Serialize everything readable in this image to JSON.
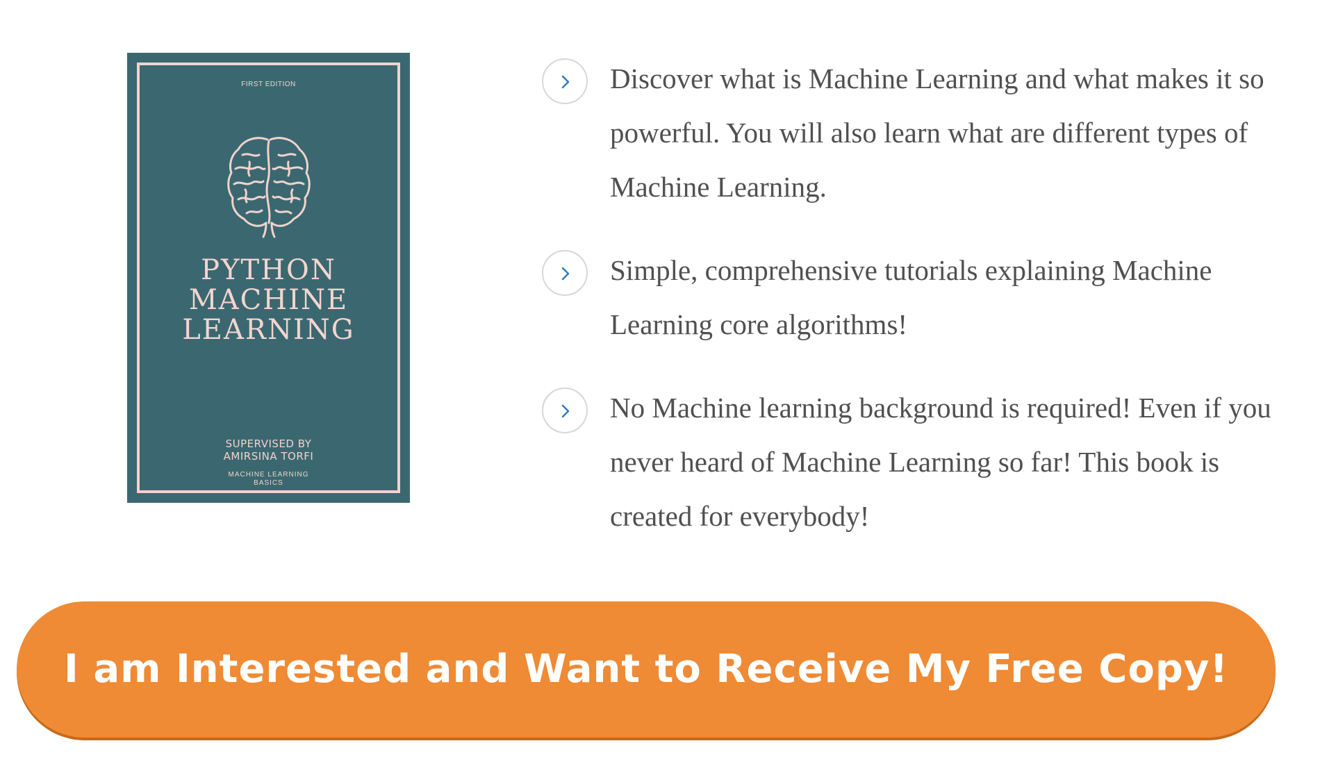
{
  "book": {
    "edition": "FIRST EDITION",
    "title_lines": [
      "PYTHON",
      "MACHINE",
      "LEARNING"
    ],
    "supervised_lines": [
      "SUPERVISED BY",
      "AMIRSINA TORFI"
    ],
    "series_lines": [
      "MACHINE LEARNING",
      "BASICS"
    ],
    "brain_icon": "brain-icon",
    "colors": {
      "cover": "#3b6870",
      "ink": "#f1d3ce"
    }
  },
  "features": [
    {
      "icon": "chevron-right-icon",
      "text": "Discover what is Machine Learning and what makes it so powerful. You will also learn what are different types of Machine Learning."
    },
    {
      "icon": "chevron-right-icon",
      "text": "Simple, comprehensive tutorials explaining Machine Learning core algorithms!"
    },
    {
      "icon": "chevron-right-icon",
      "text": "No Machine learning background is required! Even if you never heard of Machine Learning so far! This book is created for everybody!"
    }
  ],
  "cta": {
    "label": "I am Interested and Want to Receive My Free Copy!",
    "color": "#ef8a35"
  }
}
